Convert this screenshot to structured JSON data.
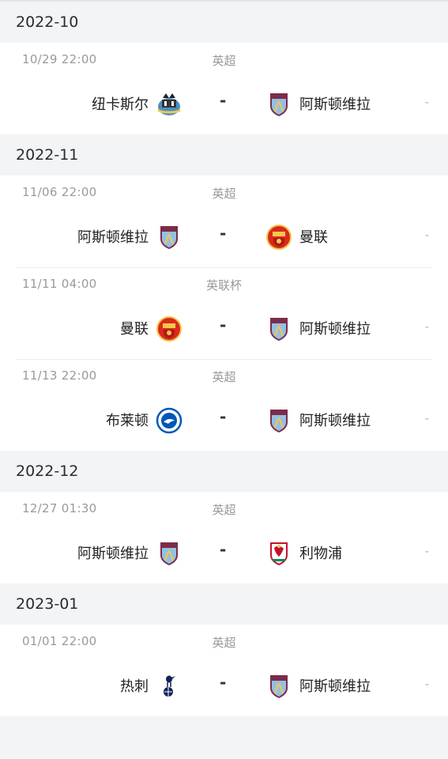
{
  "months": [
    {
      "label": "2022-10",
      "matches": [
        {
          "time": "10/29  22:00",
          "competition": "英超",
          "home": "纽卡斯尔",
          "home_logo": "newcastle-crest",
          "away": "阿斯顿维拉",
          "away_logo": "aston-villa-crest",
          "separator": "-",
          "score": "-"
        }
      ]
    },
    {
      "label": "2022-11",
      "matches": [
        {
          "time": "11/06  22:00",
          "competition": "英超",
          "home": "阿斯顿维拉",
          "home_logo": "aston-villa-crest",
          "away": "曼联",
          "away_logo": "man-utd-crest",
          "separator": "-",
          "score": "-"
        },
        {
          "time": "11/11  04:00",
          "competition": "英联杯",
          "home": "曼联",
          "home_logo": "man-utd-crest",
          "away": "阿斯顿维拉",
          "away_logo": "aston-villa-crest",
          "separator": "-",
          "score": "-"
        },
        {
          "time": "11/13  22:00",
          "competition": "英超",
          "home": "布莱顿",
          "home_logo": "brighton-crest",
          "away": "阿斯顿维拉",
          "away_logo": "aston-villa-crest",
          "separator": "-",
          "score": "-"
        }
      ]
    },
    {
      "label": "2022-12",
      "matches": [
        {
          "time": "12/27  01:30",
          "competition": "英超",
          "home": "阿斯顿维拉",
          "home_logo": "aston-villa-crest",
          "away": "利物浦",
          "away_logo": "liverpool-crest",
          "separator": "-",
          "score": "-"
        }
      ]
    },
    {
      "label": "2023-01",
      "matches": [
        {
          "time": "01/01  22:00",
          "competition": "英超",
          "home": "热刺",
          "home_logo": "tottenham-crest",
          "away": "阿斯顿维拉",
          "away_logo": "aston-villa-crest",
          "separator": "-",
          "score": "-"
        }
      ]
    }
  ],
  "colors": {
    "page_bg": "#f3f4f6",
    "card_bg": "#ffffff",
    "muted_text": "#9a9a9a",
    "villa_claret": "#7b2c4a",
    "villa_blue": "#95bfe5",
    "man_utd_red": "#da291c",
    "liverpool_red": "#c8102e",
    "brighton_blue": "#0057b8",
    "spurs_navy": "#132257"
  }
}
